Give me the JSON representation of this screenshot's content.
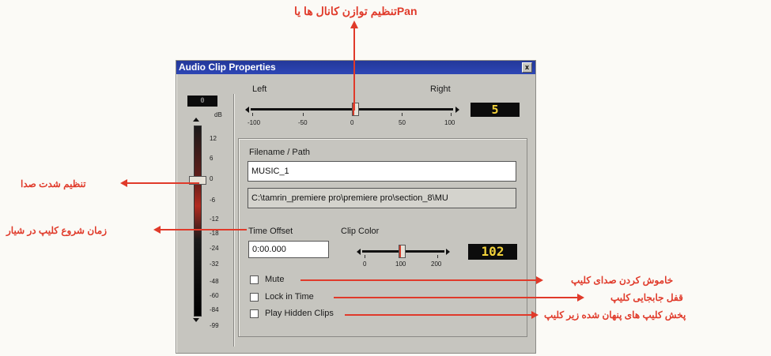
{
  "window": {
    "title": "Audio Clip Properties",
    "close_glyph": "x"
  },
  "pan": {
    "left_label": "Left",
    "right_label": "Right",
    "ticks": [
      "-100",
      "-50",
      "0",
      "50",
      "100"
    ],
    "value": "5"
  },
  "meter": {
    "readout": "0",
    "db_label": "dB",
    "ticks": [
      "12",
      "6",
      "0",
      "-6",
      "-12",
      "-18",
      "-24",
      "-32",
      "-48",
      "-60",
      "-84",
      "-99"
    ]
  },
  "file": {
    "label": "Filename / Path",
    "name_value": "MUSIC_1",
    "path_value": "C:\\tamrin_premiere pro\\premiere pro\\section_8\\MU"
  },
  "time_offset": {
    "label": "Time Offset",
    "value": "0:00.000"
  },
  "clip_color": {
    "label": "Clip Color",
    "ticks": [
      "0",
      "100",
      "200"
    ],
    "value": "102"
  },
  "checkboxes": [
    {
      "label": "Mute",
      "checked": false
    },
    {
      "label": "Lock in Time",
      "checked": false
    },
    {
      "label": "Play Hidden Clips",
      "checked": false
    }
  ],
  "annotations": {
    "pan": "تنظیم توازن کانال ها یاPan",
    "volume": "تنظیم شدت صدا",
    "offset": "زمان شروع کلیپ در شیار",
    "mute": "خاموش کردن صدای کلیپ",
    "lock": "قفل جابجایی کلیپ",
    "hidden": "پخش کلیپ های پنهان شده زیر کلیپ"
  },
  "colors": {
    "title_bar": "#2d46b5",
    "annotation": "#e03a2a",
    "digital_text": "#f2d23a"
  }
}
